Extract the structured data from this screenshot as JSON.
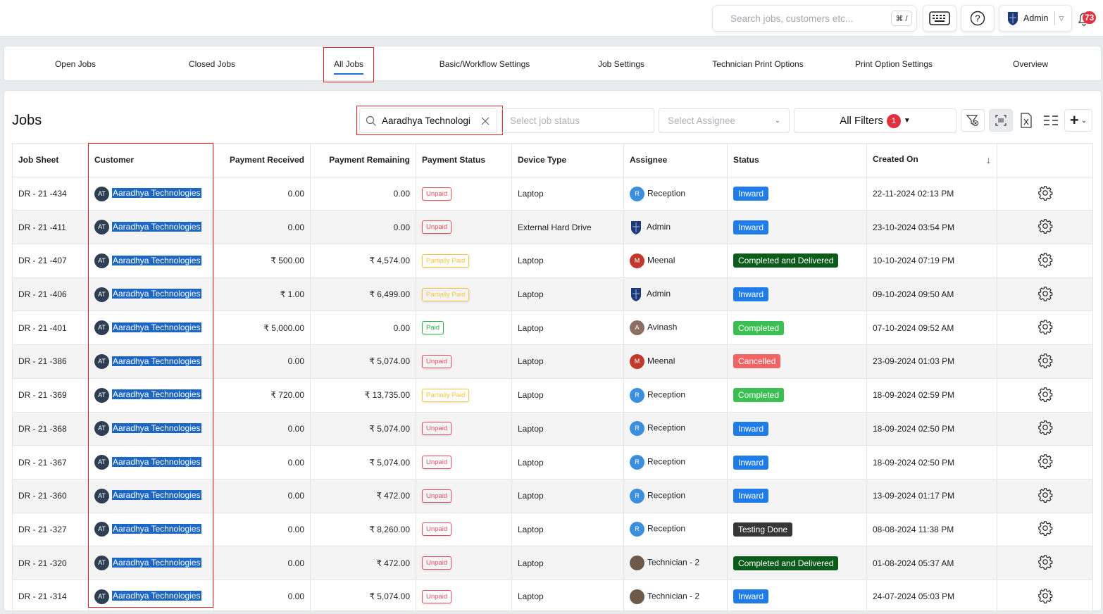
{
  "topbar": {
    "search_placeholder": "Search jobs, customers etc...",
    "shortcut": "⌘ /",
    "user": "Admin",
    "notifications": "73"
  },
  "tabs": [
    "Open Jobs",
    "Closed Jobs",
    "All Jobs",
    "Basic/Workflow Settings",
    "Job Settings",
    "Technician Print Options",
    "Print Option Settings",
    "Overview"
  ],
  "active_tab": "All Jobs",
  "page_title": "Jobs",
  "filters": {
    "search_value": "Aaradhya Technologies",
    "status_placeholder": "Select job status",
    "assignee_placeholder": "Select Assignee",
    "all_filters": "All Filters",
    "filter_count": "1"
  },
  "columns": [
    "Job Sheet",
    "Customer",
    "Payment Received",
    "Payment Remaining",
    "Payment Status",
    "Device Type",
    "Assignee",
    "Status",
    "Created On",
    ""
  ],
  "colors": {
    "unpaid": "#e0505b",
    "partial": "#f5c542",
    "paid": "#2fb344",
    "Inward": "#1f7ce8",
    "Completed and Delivered": "#0b5c1a",
    "Completed": "#3bbf52",
    "Cancelled": "#f26464",
    "Testing Done": "#363636"
  },
  "rows": [
    [
      "DR - 21 -434",
      "Aaradhya Technologies",
      "0.00",
      "0.00",
      "Unpaid",
      "Laptop",
      "Reception",
      "Inward",
      "22-11-2024 02:13 PM"
    ],
    [
      "DR - 21 -411",
      "Aaradhya Technologies",
      "0.00",
      "0.00",
      "Unpaid",
      "External Hard Drive",
      "Admin",
      "Inward",
      "23-10-2024 03:54 PM"
    ],
    [
      "DR - 21 -407",
      "Aaradhya Technologies",
      "₹ 500.00",
      "₹ 4,574.00",
      "Partially Paid",
      "Laptop",
      "Meenal",
      "Completed and Delivered",
      "10-10-2024 07:19 PM"
    ],
    [
      "DR - 21 -406",
      "Aaradhya Technologies",
      "₹ 1.00",
      "₹ 6,499.00",
      "Partially Paid",
      "Laptop",
      "Admin",
      "Inward",
      "09-10-2024 09:50 AM"
    ],
    [
      "DR - 21 -401",
      "Aaradhya Technologies",
      "₹ 5,000.00",
      "0.00",
      "Paid",
      "Laptop",
      "Avinash",
      "Completed",
      "07-10-2024 09:52 AM"
    ],
    [
      "DR - 21 -386",
      "Aaradhya Technologies",
      "0.00",
      "₹ 5,074.00",
      "Unpaid",
      "Laptop",
      "Meenal",
      "Cancelled",
      "23-09-2024 01:03 PM"
    ],
    [
      "DR - 21 -369",
      "Aaradhya Technologies",
      "₹ 720.00",
      "₹ 13,735.00",
      "Partially Paid",
      "Laptop",
      "Reception",
      "Completed",
      "18-09-2024 02:59 PM"
    ],
    [
      "DR - 21 -368",
      "Aaradhya Technologies",
      "0.00",
      "₹ 5,074.00",
      "Unpaid",
      "Laptop",
      "Reception",
      "Inward",
      "18-09-2024 02:50 PM"
    ],
    [
      "DR - 21 -367",
      "Aaradhya Technologies",
      "0.00",
      "₹ 5,074.00",
      "Unpaid",
      "Laptop",
      "Reception",
      "Inward",
      "18-09-2024 02:50 PM"
    ],
    [
      "DR - 21 -360",
      "Aaradhya Technologies",
      "0.00",
      "₹ 472.00",
      "Unpaid",
      "Laptop",
      "Reception",
      "Inward",
      "13-09-2024 01:17 PM"
    ],
    [
      "DR - 21 -327",
      "Aaradhya Technologies",
      "0.00",
      "₹ 8,260.00",
      "Unpaid",
      "Laptop",
      "Reception",
      "Testing Done",
      "08-08-2024 11:38 PM"
    ],
    [
      "DR - 21 -320",
      "Aaradhya Technologies",
      "0.00",
      "₹ 472.00",
      "Unpaid",
      "Laptop",
      "Technician - 2",
      "Completed and Delivered",
      "01-08-2024 05:37 AM"
    ],
    [
      "DR - 21 -314",
      "Aaradhya Technologies",
      "0.00",
      "₹ 5,074.00",
      "Unpaid",
      "Laptop",
      "Technician - 2",
      "Inward",
      "24-07-2024 05:03 PM"
    ]
  ]
}
